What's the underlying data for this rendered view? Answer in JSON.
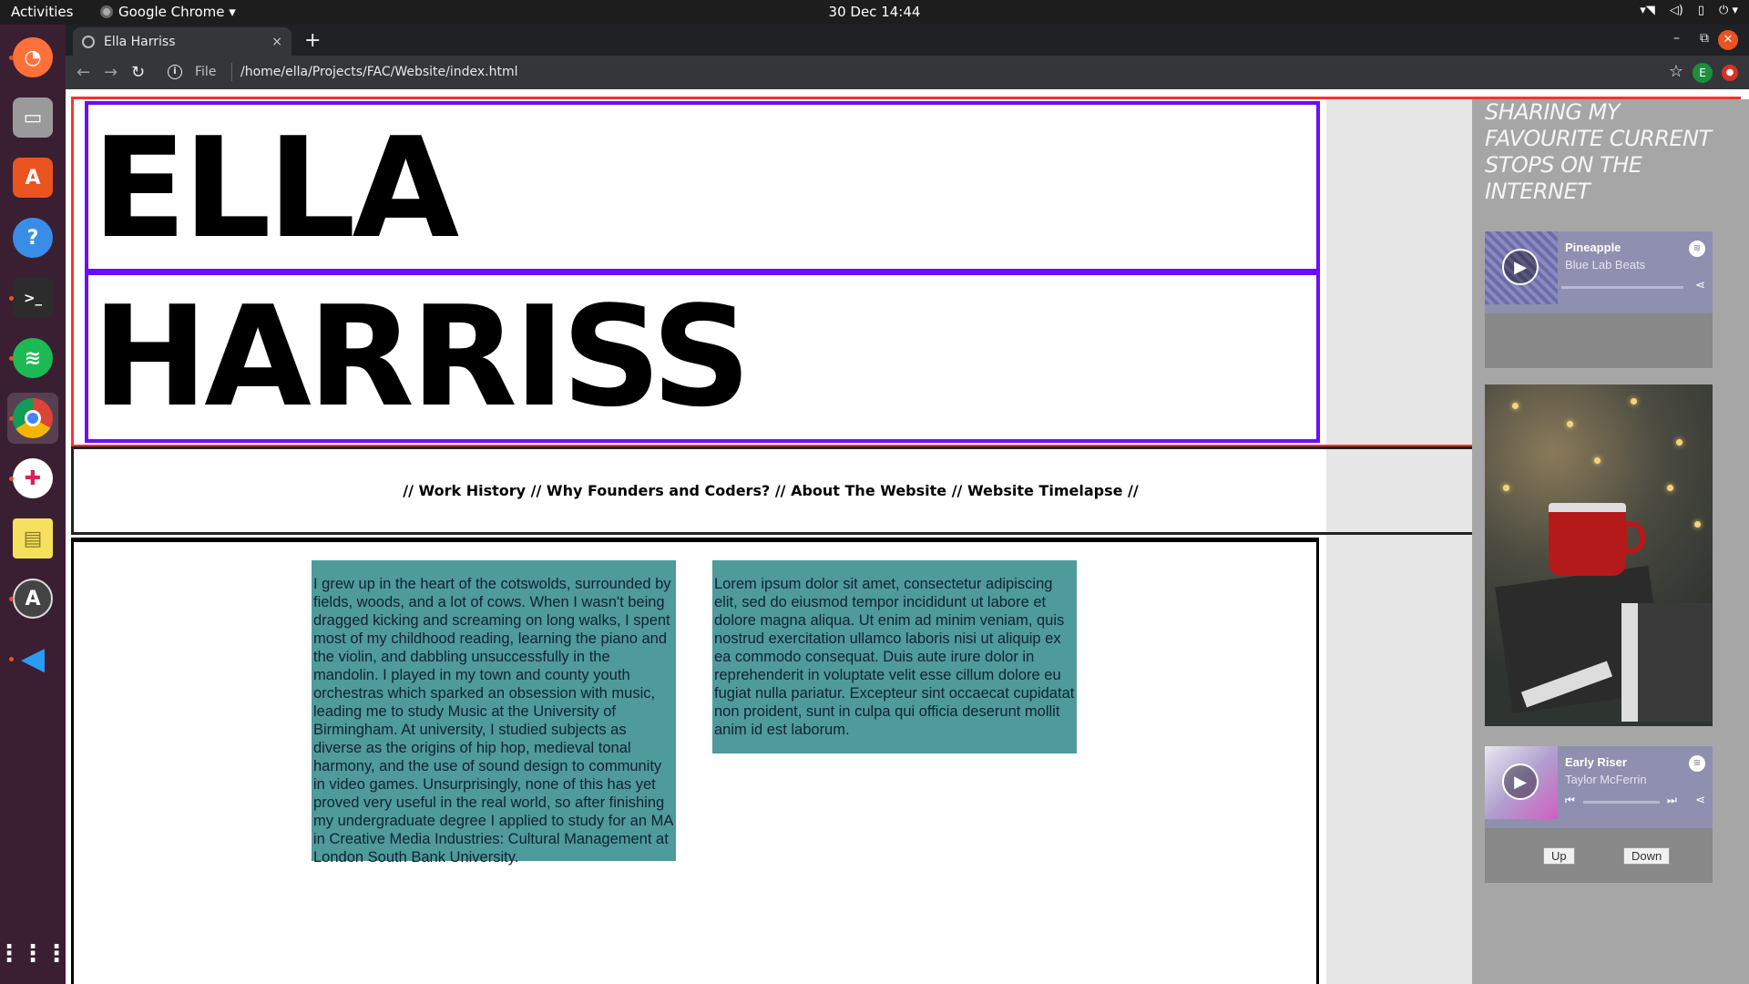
{
  "os": {
    "activities": "Activities",
    "app_menu": "Google Chrome ▾",
    "clock": "30 Dec  14:44",
    "tray": [
      "wifi-icon",
      "volume-icon",
      "phone-icon",
      "power-icon"
    ]
  },
  "dock": {
    "apps": [
      {
        "name": "firefox-icon",
        "color": "#ff7139",
        "glyph": "🦊"
      },
      {
        "name": "files-icon",
        "color": "#8d8d8d",
        "glyph": "▭"
      },
      {
        "name": "software-icon",
        "color": "#e95420",
        "glyph": "A"
      },
      {
        "name": "help-icon",
        "color": "#3a8de6",
        "glyph": "?"
      },
      {
        "name": "terminal-icon",
        "color": "#2c2c2c",
        "glyph": ">_"
      },
      {
        "name": "spotify-icon",
        "color": "#1db954",
        "glyph": "≋"
      },
      {
        "name": "chrome-icon",
        "color": "#dd4b39",
        "glyph": "◉"
      },
      {
        "name": "slack-icon",
        "color": "#ffffff",
        "glyph": "✚"
      },
      {
        "name": "notes-icon",
        "color": "#f6e05e",
        "glyph": "▤"
      },
      {
        "name": "updater-icon",
        "color": "#444444",
        "glyph": "A"
      },
      {
        "name": "vscode-icon",
        "color": "#0078d4",
        "glyph": "◀"
      }
    ],
    "grid_icon": "apps-grid-icon"
  },
  "browser": {
    "tab_title": "Ella Harriss",
    "tab_close": "×",
    "new_tab": "+",
    "scheme": "File",
    "url": "/home/ella/Projects/FAC/Website/index.html",
    "avatar_letter": "E"
  },
  "page": {
    "name_line1": "ELLA",
    "name_line2": "HARRISS",
    "nav_text": "// Work History // Why Founders and Coders? // About The Website // Website Timelapse //",
    "card1": "I grew up in the heart of the cotswolds, surrounded by fields, woods, and a lot of cows. When I wasn't being dragged kicking and screaming on long walks, I spent most of my childhood reading, learning the piano and the violin, and dabbling unsuccessfully in the mandolin. I played in my town and county youth orchestras which sparked an obsession with music, leading me to study Music at the University of Birmingham. At university, I studied subjects as diverse as the origins of hip hop, medieval tonal harmony, and the use of sound design to community in video games. Unsurprisingly, none of this has yet proved very useful in the real world, so after finishing my undergraduate degree I applied to study for an MA in Creative Media Industries: Cultural Management at London South Bank University.",
    "card2": "Lorem ipsum dolor sit amet, consectetur adipiscing elit, sed do eiusmod tempor incididunt ut labore et dolore magna aliqua. Ut enim ad minim veniam, quis nostrud exercitation ullamco laboris nisi ut aliquip ex ea commodo consequat. Duis aute irure dolor in reprehenderit in voluptate velit esse cillum dolore eu fugiat nulla pariatur. Excepteur sint occaecat cupidatat non proident, sunt in culpa qui officia deserunt mollit anim id est laborum.",
    "right_heading": "SHARING MY FAVOURITE CURRENT STOPS ON THE INTERNET",
    "track1": {
      "title": "Pineapple",
      "artist": "Blue Lab Beats"
    },
    "track2": {
      "title": "Early Riser",
      "artist": "Taylor McFerrin"
    },
    "btn_up": "Up",
    "btn_down": "Down"
  },
  "colors": {
    "header_border": "#ff3030",
    "name_border": "#6a0dff",
    "card_bg": "#4f9a9a",
    "right_panel": "#a6a6a6"
  }
}
